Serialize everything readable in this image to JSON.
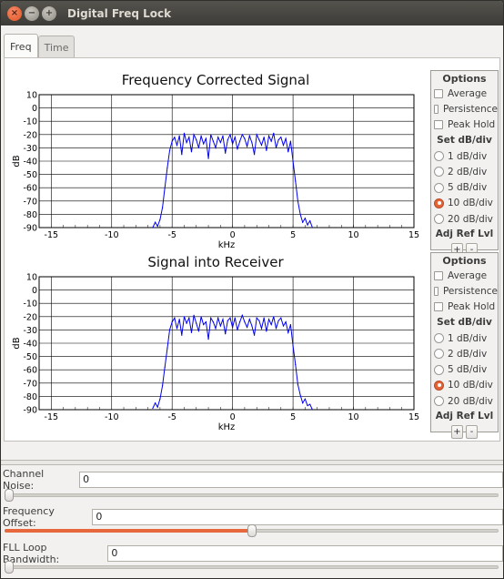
{
  "window": {
    "title": "Digital Freq Lock"
  },
  "tabs": [
    {
      "label": "Freq",
      "active": true
    },
    {
      "label": "Time",
      "active": false
    }
  ],
  "plots": [
    {
      "title": "Frequency Corrected Signal",
      "ylabel": "dB",
      "xlabel": "kHz",
      "options": {
        "title": "Options",
        "average_label": "Average",
        "persistence_label": "Persistence",
        "peak_hold_label": "Peak Hold",
        "set_db_label": "Set dB/div",
        "db_options": [
          "1 dB/div",
          "2 dB/div",
          "5 dB/div",
          "10 dB/div",
          "20 dB/div"
        ],
        "selected_db": "10 dB/div",
        "adj_ref_label": "Adj Ref Lvl",
        "plus_label": "+",
        "minus_label": "-"
      }
    },
    {
      "title": "Signal into Receiver",
      "ylabel": "dB",
      "xlabel": "kHz",
      "options": {
        "title": "Options",
        "average_label": "Average",
        "persistence_label": "Persistence",
        "peak_hold_label": "Peak Hold",
        "set_db_label": "Set dB/div",
        "db_options": [
          "1 dB/div",
          "2 dB/div",
          "5 dB/div",
          "10 dB/div",
          "20 dB/div"
        ],
        "selected_db": "10 dB/div",
        "adj_ref_label": "Adj Ref Lvl",
        "plus_label": "+",
        "minus_label": "-"
      }
    }
  ],
  "chart_data": [
    {
      "type": "line",
      "title": "Frequency Corrected Signal",
      "xlabel": "kHz",
      "ylabel": "dB",
      "xlim": [
        -16,
        15
      ],
      "ylim": [
        -90,
        10
      ],
      "xticks": [
        -15,
        -10,
        -5,
        0,
        5,
        10,
        15
      ],
      "yticks": [
        10,
        0,
        -10,
        -20,
        -30,
        -40,
        -50,
        -60,
        -70,
        -80,
        -90
      ],
      "grid": true,
      "series": [
        {
          "color": "#0000ee",
          "x": [
            -6.6,
            -6.4,
            -6.2,
            -6.0,
            -5.8,
            -5.6,
            -5.4,
            -5.2,
            -5.0,
            -4.8,
            -4.6,
            -4.4,
            -4.2,
            -4.0,
            -3.8,
            -3.6,
            -3.4,
            -3.2,
            -3.0,
            -2.8,
            -2.6,
            -2.4,
            -2.2,
            -2.0,
            -1.8,
            -1.6,
            -1.4,
            -1.2,
            -1.0,
            -0.8,
            -0.6,
            -0.4,
            -0.2,
            0.0,
            0.2,
            0.4,
            0.6,
            0.8,
            1.0,
            1.2,
            1.4,
            1.6,
            1.8,
            2.0,
            2.2,
            2.4,
            2.6,
            2.8,
            3.0,
            3.2,
            3.4,
            3.6,
            3.8,
            4.0,
            4.2,
            4.4,
            4.6,
            4.8,
            5.0,
            5.2,
            5.4,
            5.6,
            5.8,
            6.0,
            6.2,
            6.4,
            6.6
          ],
          "y": [
            -90,
            -86,
            -89,
            -84,
            -75,
            -60,
            -45,
            -32,
            -25,
            -22,
            -28,
            -21,
            -35,
            -19,
            -26,
            -22,
            -33,
            -20,
            -24,
            -30,
            -21,
            -27,
            -23,
            -38,
            -20,
            -25,
            -30,
            -22,
            -26,
            -21,
            -34,
            -24,
            -20,
            -27,
            -22,
            -31,
            -25,
            -20,
            -23,
            -29,
            -21,
            -26,
            -35,
            -20,
            -24,
            -28,
            -22,
            -32,
            -21,
            -25,
            -19,
            -30,
            -24,
            -22,
            -28,
            -23,
            -33,
            -25,
            -40,
            -55,
            -70,
            -80,
            -86,
            -83,
            -88,
            -85,
            -90
          ]
        }
      ]
    },
    {
      "type": "line",
      "title": "Signal into Receiver",
      "xlabel": "kHz",
      "ylabel": "dB",
      "xlim": [
        -16,
        15
      ],
      "ylim": [
        -90,
        10
      ],
      "xticks": [
        -15,
        -10,
        -5,
        0,
        5,
        10,
        15
      ],
      "yticks": [
        10,
        0,
        -10,
        -20,
        -30,
        -40,
        -50,
        -60,
        -70,
        -80,
        -90
      ],
      "grid": true,
      "series": [
        {
          "color": "#0000ee",
          "x": [
            -6.6,
            -6.4,
            -6.2,
            -6.0,
            -5.8,
            -5.6,
            -5.4,
            -5.2,
            -5.0,
            -4.8,
            -4.6,
            -4.4,
            -4.2,
            -4.0,
            -3.8,
            -3.6,
            -3.4,
            -3.2,
            -3.0,
            -2.8,
            -2.6,
            -2.4,
            -2.2,
            -2.0,
            -1.8,
            -1.6,
            -1.4,
            -1.2,
            -1.0,
            -0.8,
            -0.6,
            -0.4,
            -0.2,
            0.0,
            0.2,
            0.4,
            0.6,
            0.8,
            1.0,
            1.2,
            1.4,
            1.6,
            1.8,
            2.0,
            2.2,
            2.4,
            2.6,
            2.8,
            3.0,
            3.2,
            3.4,
            3.6,
            3.8,
            4.0,
            4.2,
            4.4,
            4.6,
            4.8,
            5.0,
            5.2,
            5.4,
            5.6,
            5.8,
            6.0,
            6.2,
            6.4,
            6.6
          ],
          "y": [
            -89,
            -85,
            -88,
            -82,
            -72,
            -58,
            -44,
            -30,
            -24,
            -21,
            -29,
            -22,
            -34,
            -20,
            -25,
            -21,
            -32,
            -19,
            -25,
            -31,
            -20,
            -26,
            -24,
            -37,
            -21,
            -24,
            -29,
            -21,
            -27,
            -22,
            -33,
            -23,
            -21,
            -28,
            -21,
            -30,
            -24,
            -19,
            -24,
            -28,
            -22,
            -27,
            -34,
            -21,
            -23,
            -29,
            -21,
            -31,
            -22,
            -26,
            -20,
            -29,
            -23,
            -21,
            -27,
            -24,
            -32,
            -26,
            -42,
            -56,
            -71,
            -79,
            -85,
            -82,
            -87,
            -86,
            -90
          ]
        }
      ]
    }
  ],
  "controls": {
    "channel_noise": {
      "label": "Channel Noise:",
      "value": "0",
      "slider": 0.0
    },
    "frequency_offset": {
      "label": "Frequency Offset:",
      "value": "0",
      "slider": 0.5
    },
    "fll_loop_bandwidth": {
      "label": "FLL Loop Bandwidth:",
      "value": "0",
      "slider": 0.0
    }
  },
  "colors": {
    "accent": "#e6683c",
    "trace": "#0000ee",
    "titlebar": "#3c3b37"
  }
}
